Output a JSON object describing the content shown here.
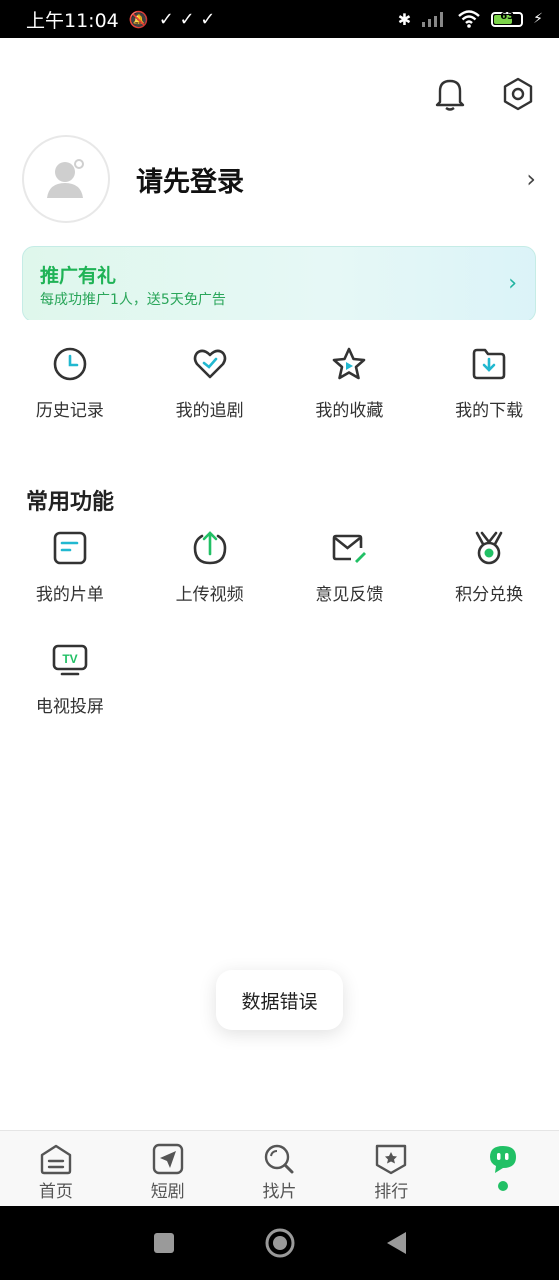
{
  "status_bar": {
    "time": "上午11:04",
    "battery": "63"
  },
  "header": {
    "bell_icon": "bell-icon",
    "settings_icon": "settings-hex-icon"
  },
  "profile": {
    "login_text": "请先登录"
  },
  "promo": {
    "title": "推广有礼",
    "subtitle": "每成功推广1人，送5天免广告"
  },
  "quick_actions": [
    {
      "label": "历史记录",
      "icon": "clock-icon"
    },
    {
      "label": "我的追剧",
      "icon": "heart-check-icon"
    },
    {
      "label": "我的收藏",
      "icon": "star-icon"
    },
    {
      "label": "我的下载",
      "icon": "download-folder-icon"
    }
  ],
  "common_functions": {
    "title": "常用功能",
    "items": [
      {
        "label": "我的片单",
        "icon": "list-icon"
      },
      {
        "label": "上传视频",
        "icon": "upload-icon"
      },
      {
        "label": "意见反馈",
        "icon": "feedback-mail-icon"
      },
      {
        "label": "积分兑换",
        "icon": "medal-icon"
      },
      {
        "label": "电视投屏",
        "icon": "tv-icon"
      }
    ]
  },
  "toast": {
    "message": "数据错误"
  },
  "tabbar": [
    {
      "label": "首页",
      "icon": "home-icon"
    },
    {
      "label": "短剧",
      "icon": "send-icon"
    },
    {
      "label": "找片",
      "icon": "search-icon"
    },
    {
      "label": "排行",
      "icon": "rank-icon"
    },
    {
      "label": "",
      "icon": "mascot-icon",
      "active": true
    }
  ],
  "colors": {
    "accent": "#21c065",
    "promo_title": "#1fb356"
  }
}
